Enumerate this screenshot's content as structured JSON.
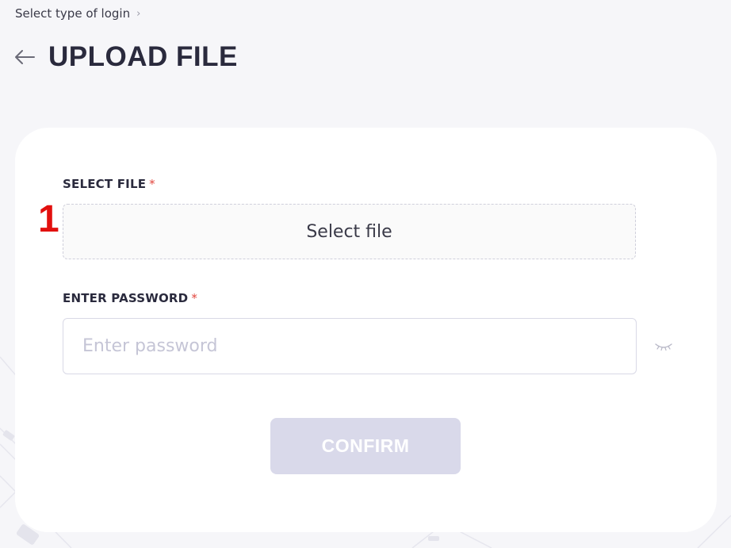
{
  "breadcrumb": {
    "item": "Select type of login",
    "separator": "›"
  },
  "header": {
    "back_icon": "arrow-left-icon",
    "title": "UPLOAD FILE"
  },
  "form": {
    "step_number": "1",
    "file_field": {
      "label": "SELECT FILE",
      "required_mark": "*",
      "button_text": "Select file"
    },
    "password_field": {
      "label": "ENTER PASSWORD",
      "required_mark": "*",
      "placeholder": "Enter password",
      "value": "",
      "toggle_icon": "eye-closed-icon"
    },
    "confirm_button": {
      "label": "CONFIRM",
      "disabled": true
    }
  },
  "colors": {
    "page_background": "#f6f6f9",
    "card_background": "#ffffff",
    "title_text": "#2a2a3d",
    "required_mark": "#e2463e",
    "step_number": "#e2100e",
    "button_disabled": "#d9d9ea",
    "placeholder": "#c5c5d6"
  }
}
